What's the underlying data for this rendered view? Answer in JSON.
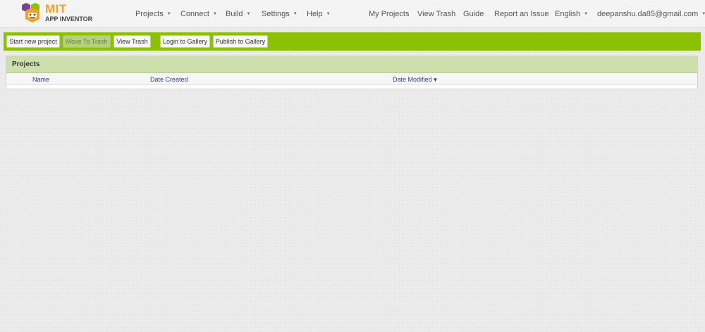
{
  "brand": {
    "name": "MIT",
    "subtitle": "APP INVENTOR",
    "colors": {
      "orange": "#f1a02a",
      "purple": "#7b3f98",
      "green": "#8cc101"
    }
  },
  "nav": {
    "menus": [
      {
        "label": "Projects",
        "icon": "caret-down-icon"
      },
      {
        "label": "Connect",
        "icon": "caret-down-icon"
      },
      {
        "label": "Build",
        "icon": "caret-down-icon"
      },
      {
        "label": "Settings",
        "icon": "caret-down-icon"
      },
      {
        "label": "Help",
        "icon": "caret-down-icon"
      }
    ],
    "links": {
      "my_projects": "My Projects",
      "view_trash": "View Trash",
      "guide": "Guide",
      "report_issue": "Report an Issue",
      "language": "English",
      "account": "deepanshu.da85@gmail.com"
    }
  },
  "toolbar": {
    "start_new_project": "Start new project",
    "move_to_trash": "Move To Trash",
    "view_trash": "View Trash",
    "login_gallery": "Login to Gallery",
    "publish_gallery": "Publish to Gallery",
    "background_color": "#8cc101"
  },
  "projects_panel": {
    "title": "Projects",
    "columns": {
      "name": "Name",
      "date_created": "Date Created",
      "date_modified": "Date Modified"
    },
    "sort_indicator": "▼",
    "sort_icon": "sort-descending-icon",
    "rows": []
  }
}
